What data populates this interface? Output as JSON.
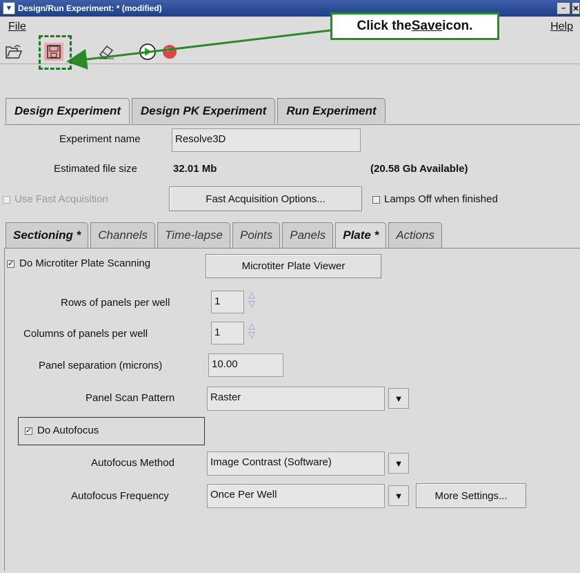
{
  "window": {
    "title": "Design/Run Experiment:  * (modified)",
    "min_label": "–",
    "close_label": "✕"
  },
  "menu": {
    "file": "File",
    "help": "Help"
  },
  "callout": {
    "prefix": "Click the ",
    "link": "Save",
    "suffix": " icon."
  },
  "tabs_main": [
    "Design Experiment",
    "Design PK Experiment",
    "Run Experiment"
  ],
  "experiment": {
    "name_label": "Experiment name",
    "name_value": "Resolve3D",
    "size_label": "Estimated file size",
    "size_value": "32.01 Mb",
    "available": "(20.58 Gb Available)",
    "fast_acq_label": "Use Fast Acquisition",
    "fast_acq_button": "Fast Acquisition Options...",
    "lamps_label": "Lamps Off when finished"
  },
  "tabs_sub": [
    "Sectioning *",
    "Channels",
    "Time-lapse",
    "Points",
    "Panels",
    "Plate *",
    "Actions"
  ],
  "plate": {
    "scan_label": "Do Microtiter Plate Scanning",
    "viewer_button": "Microtiter Plate Viewer",
    "rows_label": "Rows of panels per well",
    "rows_value": "1",
    "cols_label": "Columns of panels per well",
    "cols_value": "1",
    "sep_label": "Panel separation (microns)",
    "sep_value": "10.00",
    "pattern_label": "Panel Scan Pattern",
    "pattern_value": "Raster",
    "autofocus_label": "Do Autofocus",
    "af_method_label": "Autofocus Method",
    "af_method_value": "Image Contrast (Software)",
    "af_freq_label": "Autofocus Frequency",
    "af_freq_value": "Once Per Well",
    "more_button": "More Settings..."
  },
  "colors": {
    "callout_border": "#2a8a2a",
    "save_highlight": "#f2a7a7",
    "run_green": "#2aa32a",
    "stop_red": "#d84a4a"
  }
}
